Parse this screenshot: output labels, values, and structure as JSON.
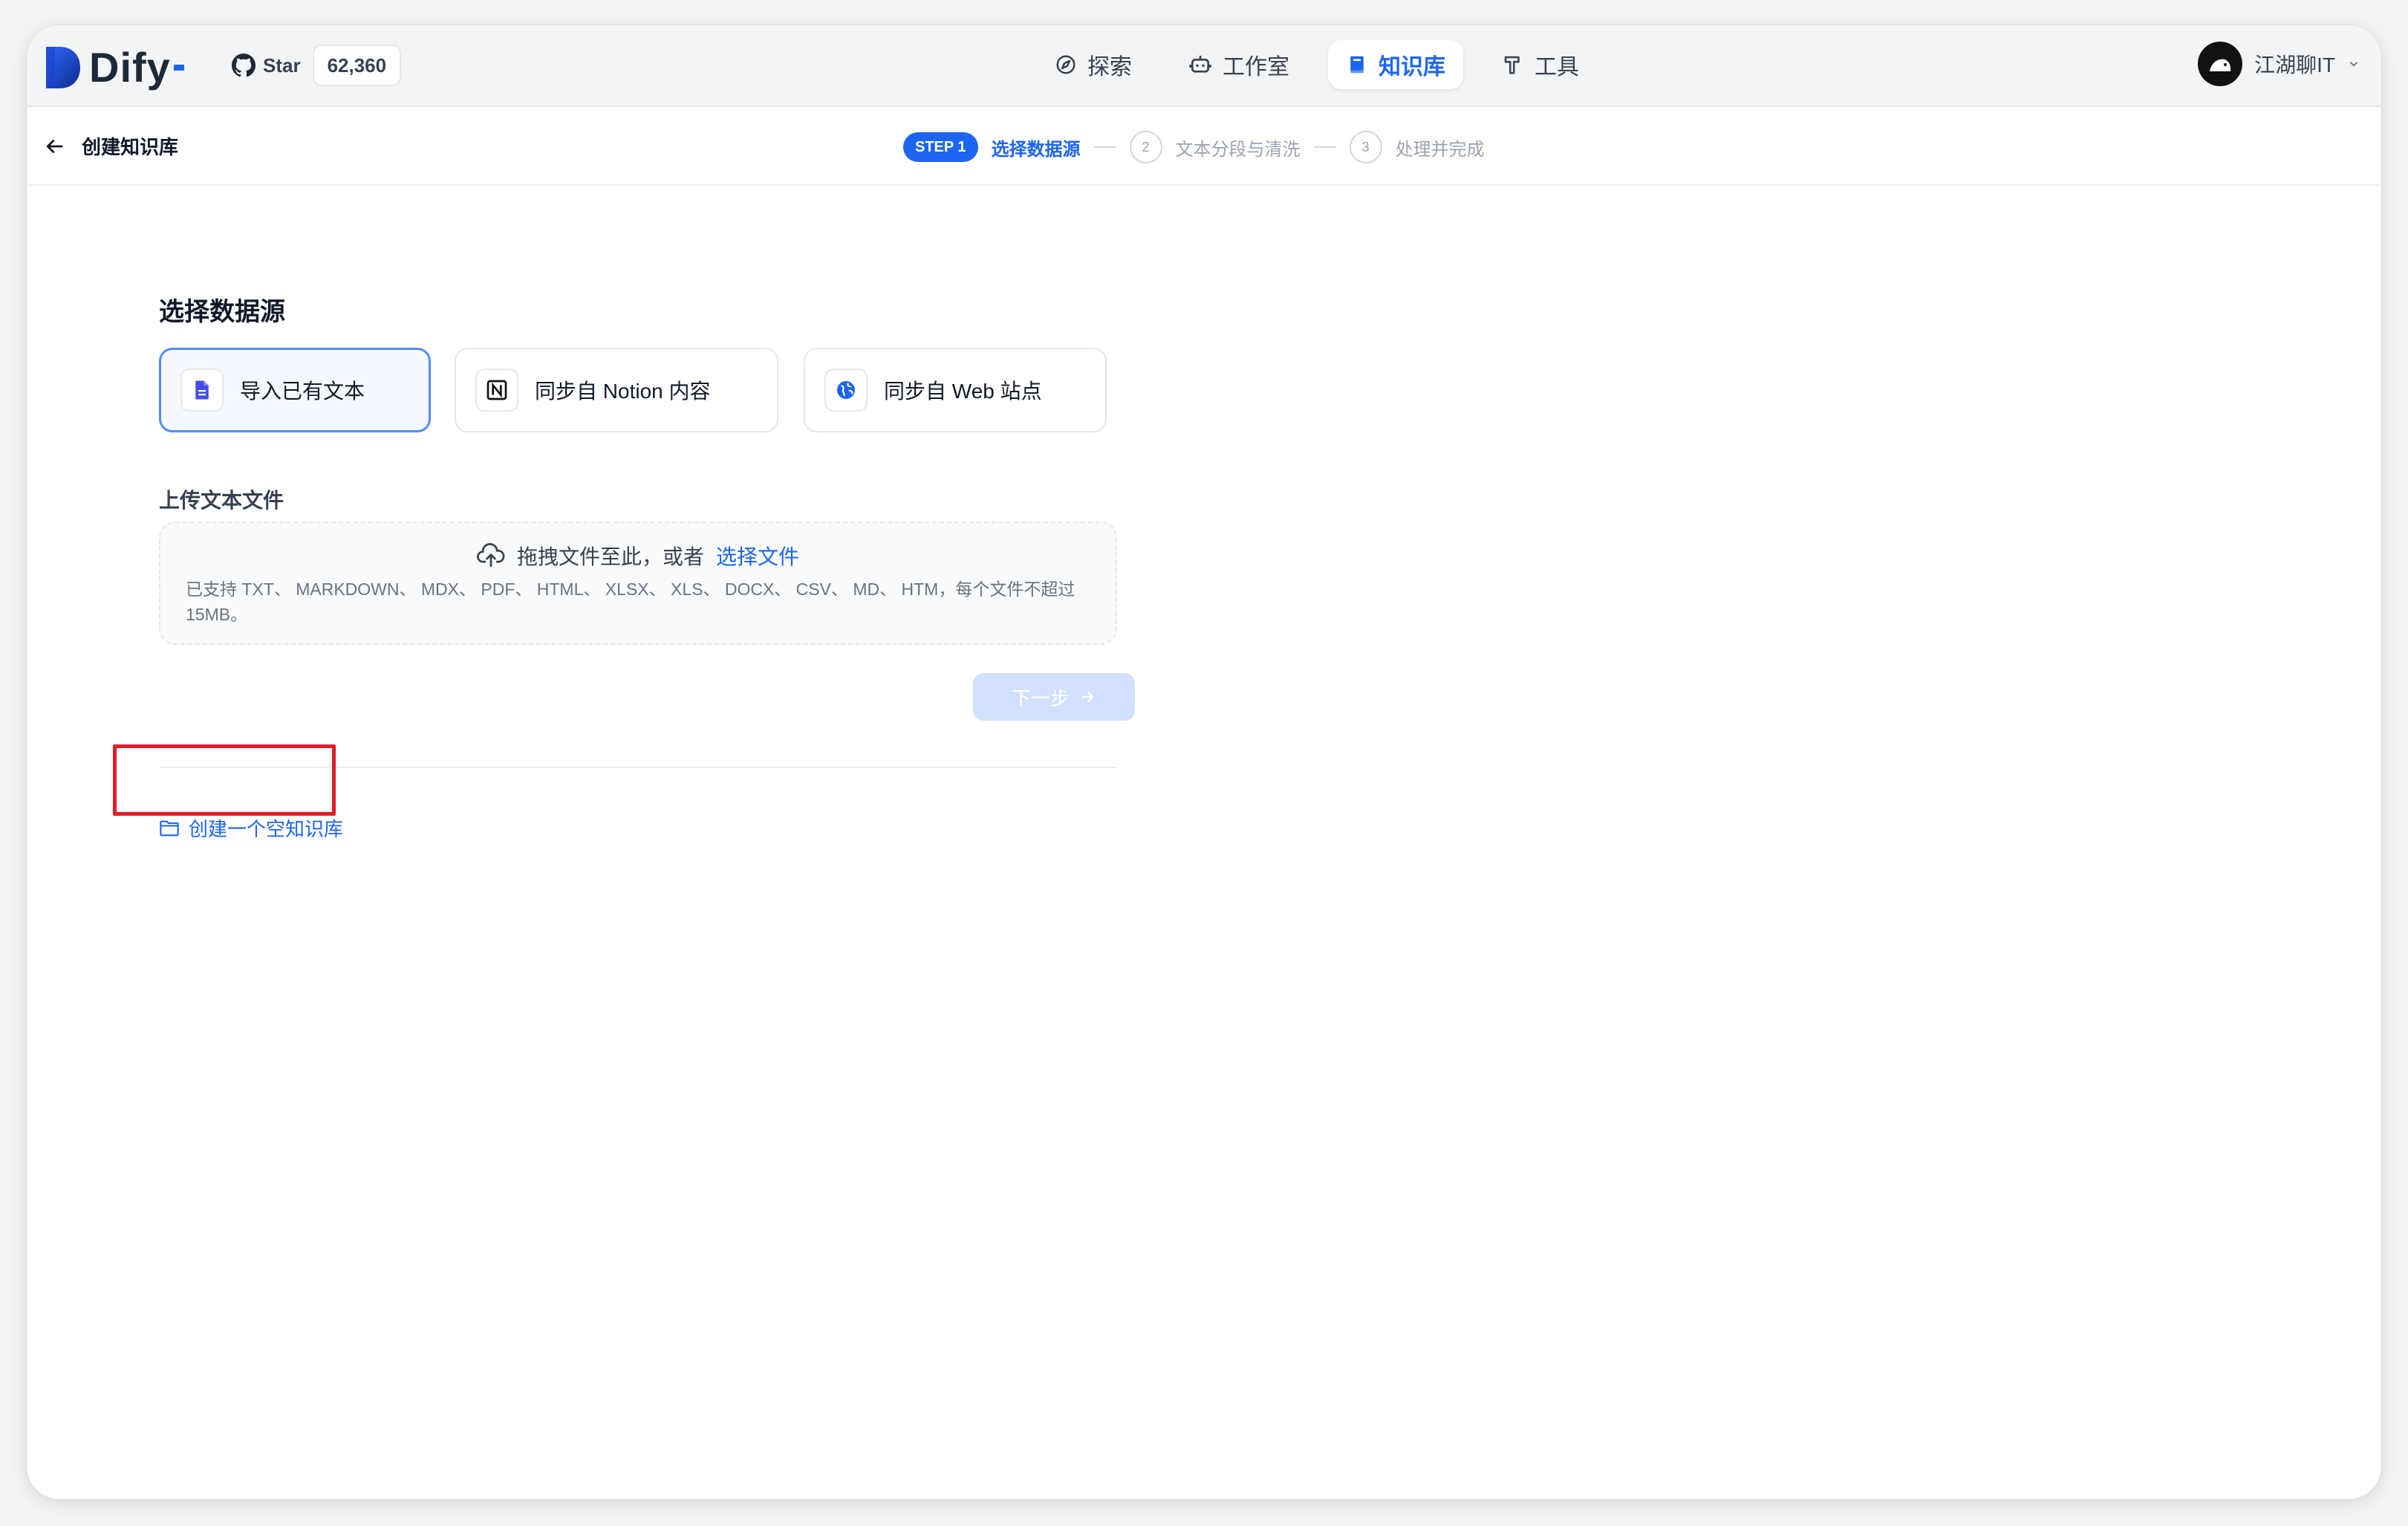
{
  "app": {
    "brand": "Dify",
    "github": {
      "star_label": "Star",
      "count": "62,360"
    },
    "nav": [
      {
        "label": "探索",
        "icon": "compass-icon",
        "active": false
      },
      {
        "label": "工作室",
        "icon": "robot-icon",
        "active": false
      },
      {
        "label": "知识库",
        "icon": "book-icon",
        "active": true
      },
      {
        "label": "工具",
        "icon": "hammer-icon",
        "active": false
      }
    ],
    "user": {
      "name": "江湖聊IT"
    }
  },
  "subheader": {
    "title": "创建知识库",
    "steps": {
      "s1_tag": "STEP 1",
      "s1_label": "选择数据源",
      "s2_num": "2",
      "s2_label": "文本分段与清洗",
      "s3_num": "3",
      "s3_label": "处理并完成"
    }
  },
  "main": {
    "section_title": "选择数据源",
    "sources": [
      {
        "label": "导入已有文本",
        "icon": "file-icon",
        "active": true
      },
      {
        "label": "同步自 Notion 内容",
        "icon": "notion-icon",
        "active": false
      },
      {
        "label": "同步自 Web 站点",
        "icon": "globe-icon",
        "active": false
      }
    ],
    "upload_label": "上传文本文件",
    "dropzone": {
      "text": "拖拽文件至此，或者",
      "link": "选择文件",
      "hint": "已支持 TXT、 MARKDOWN、 MDX、 PDF、 HTML、 XLSX、 XLS、 DOCX、 CSV、 MD、 HTM，每个文件不超过 15MB。"
    },
    "next_button": "下一步",
    "empty_link": "创建一个空知识库"
  },
  "colors": {
    "accent": "#1c64f2",
    "highlight": "#e11d2a"
  }
}
